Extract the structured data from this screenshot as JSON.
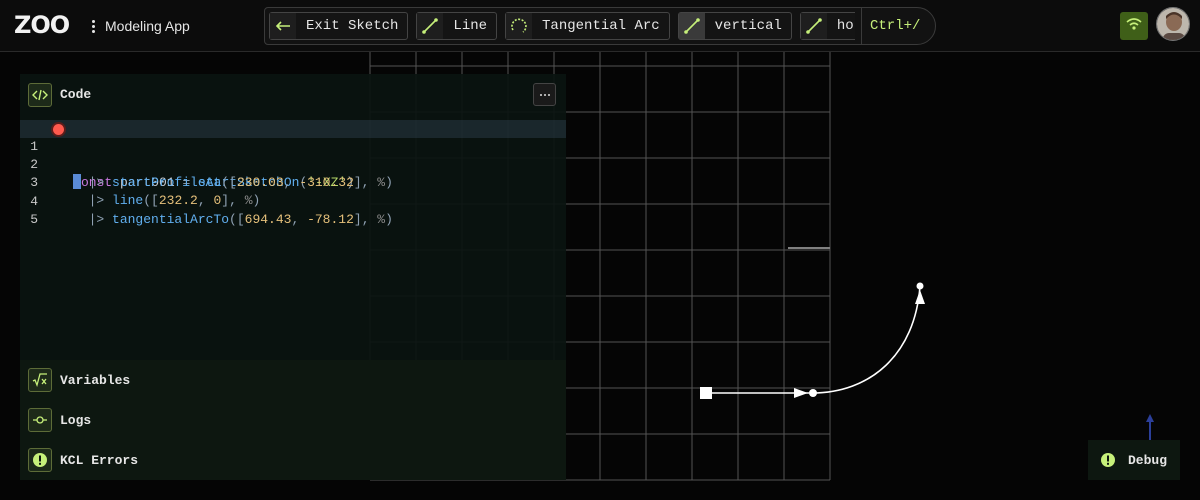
{
  "header": {
    "logo_text": "ZOO",
    "app_title": "Modeling App",
    "toolbar": [
      {
        "label": "Exit Sketch",
        "icon": "arrow-left-icon",
        "active": false
      },
      {
        "label": "Line",
        "icon": "line-icon",
        "active": false
      },
      {
        "label": "Tangential Arc",
        "icon": "tangential-arc-icon",
        "active": false
      },
      {
        "label": "vertical",
        "icon": "line-icon",
        "active": true
      },
      {
        "label": "horizontal",
        "icon": "line-icon",
        "active": false
      }
    ],
    "shortcut": "Ctrl+/",
    "network_icon": "wifi-icon",
    "avatar_icon": "user-avatar"
  },
  "code_panel": {
    "title": "Code",
    "icon": "code-icon",
    "more_icon": "more-icon",
    "line_numbers": [
      "1",
      "2",
      "3",
      "4",
      "5"
    ],
    "lines": [
      "const part001 = startSketchOn('-XZ')",
      "  |> startProfileAt([230.03, -310.32], %)",
      "  |> line([232.2, 0], %)",
      "  |> tangentialArcTo([694.43, -78.12], %)",
      ""
    ]
  },
  "panels": {
    "variables": {
      "title": "Variables",
      "icon": "sqrt-x-icon"
    },
    "logs": {
      "title": "Logs",
      "icon": "commit-icon"
    },
    "errors": {
      "title": "KCL Errors",
      "icon": "exclamation-icon"
    },
    "debug": {
      "title": "Debug",
      "icon": "exclamation-icon"
    }
  },
  "colors": {
    "accent": "#c6f07a",
    "panel_bg": "#0a1310",
    "breakpoint": "#ff5a4e",
    "grid": "#7a7a7a"
  }
}
